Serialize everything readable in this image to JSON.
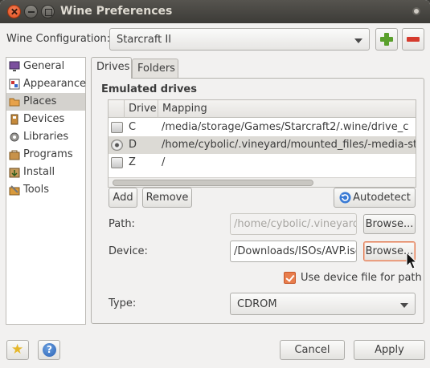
{
  "window": {
    "title": "Wine Preferences"
  },
  "config": {
    "label": "Wine Configuration:",
    "value": "Starcraft II"
  },
  "sidebar": {
    "items": [
      {
        "label": "General",
        "icon": "monitor-icon"
      },
      {
        "label": "Appearance",
        "icon": "appearance-icon"
      },
      {
        "label": "Places",
        "icon": "folder-icon",
        "active": true
      },
      {
        "label": "Devices",
        "icon": "devices-icon"
      },
      {
        "label": "Libraries",
        "icon": "gear-icon"
      },
      {
        "label": "Programs",
        "icon": "programs-icon"
      },
      {
        "label": "Install",
        "icon": "install-icon"
      },
      {
        "label": "Tools",
        "icon": "tools-icon"
      }
    ]
  },
  "tabs": [
    {
      "label": "Drives",
      "active": true
    },
    {
      "label": "Folders",
      "active": false
    }
  ],
  "drives": {
    "section_title": "Emulated drives",
    "columns": [
      "Drive",
      "Mapping"
    ],
    "rows": [
      {
        "drive": "C",
        "mapping": "/media/storage/Games/Starcraft2/.wine/drive_c",
        "type": "hd"
      },
      {
        "drive": "D",
        "mapping": "/home/cybolic/.vineyard/mounted_files/-media-sto",
        "type": "cdrom",
        "selected": true
      },
      {
        "drive": "Z",
        "mapping": "/",
        "type": "hd"
      }
    ],
    "add_label": "Add",
    "remove_label": "Remove",
    "autodetect_label": "Autodetect"
  },
  "path": {
    "label": "Path:",
    "value": "/home/cybolic/.vineyard/",
    "browse_label": "Browse..."
  },
  "device": {
    "label": "Device:",
    "value": "/Downloads/ISOs/AVP.iso",
    "browse_label": "Browse..."
  },
  "use_device_path": {
    "label": "Use device file for path",
    "checked": true
  },
  "type": {
    "label": "Type:",
    "value": "CDROM"
  },
  "footer": {
    "cancel_label": "Cancel",
    "apply_label": "Apply"
  },
  "colors": {
    "accent": "#e87d4c",
    "titlebar": "#3c3b37",
    "selection": "#dcdad5"
  }
}
